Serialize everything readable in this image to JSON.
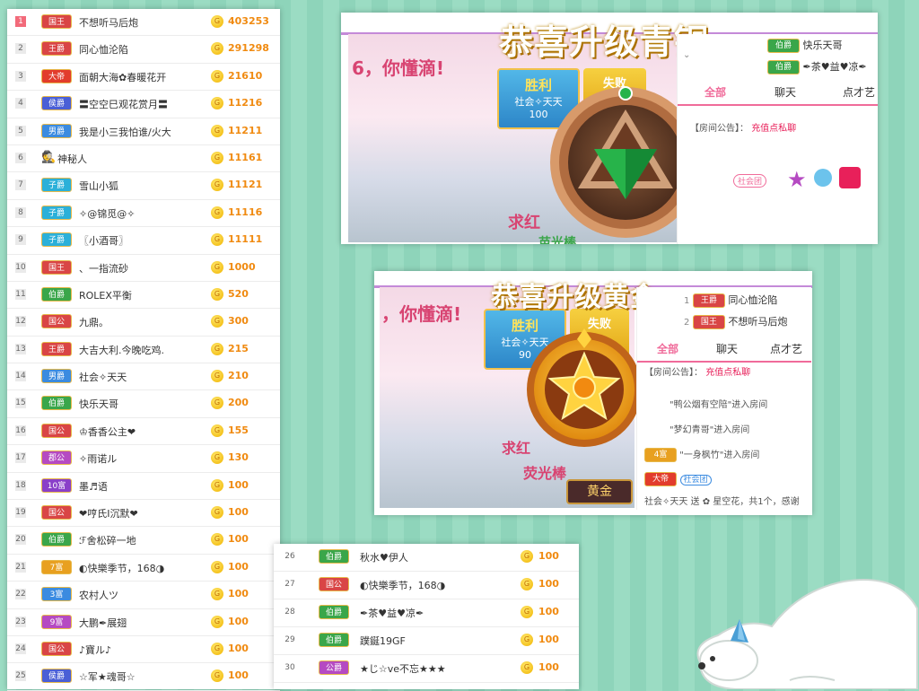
{
  "ranking": [
    {
      "rank": "1",
      "badge": "国王",
      "color": "#d94545",
      "name": "不想听马后炮",
      "score": "403253"
    },
    {
      "rank": "2",
      "badge": "王爵",
      "color": "#d94545",
      "name": "同心恤沦陷",
      "score": "291298"
    },
    {
      "rank": "3",
      "badge": "大帝",
      "color": "#e23c2c",
      "name": "面朝大海✿春暖花开",
      "score": "21610"
    },
    {
      "rank": "4",
      "badge": "侯爵",
      "color": "#4a5fd6",
      "name": "〓空空巳观花赏月〓",
      "score": "11216"
    },
    {
      "rank": "5",
      "badge": "男爵",
      "color": "#3b8be0",
      "name": "我是小三我怕谁/火大",
      "score": "11211"
    },
    {
      "rank": "6",
      "badge": "",
      "color": "",
      "name": "神秘人",
      "score": "11161"
    },
    {
      "rank": "7",
      "badge": "子爵",
      "color": "#2bb0d9",
      "name": "雪山小狐",
      "score": "11121"
    },
    {
      "rank": "8",
      "badge": "子爵",
      "color": "#2bb0d9",
      "name": "✧@锦觅@✧",
      "score": "11116"
    },
    {
      "rank": "9",
      "badge": "子爵",
      "color": "#2bb0d9",
      "name": "〖小酒哥〗",
      "score": "11111"
    },
    {
      "rank": "10",
      "badge": "国王",
      "color": "#d94545",
      "name": "、一指流砂",
      "score": "1000"
    },
    {
      "rank": "11",
      "badge": "伯爵",
      "color": "#3aa64a",
      "name": "ROLEX平衡",
      "score": "520"
    },
    {
      "rank": "12",
      "badge": "国公",
      "color": "#d94545",
      "name": "九鼎。",
      "score": "300"
    },
    {
      "rank": "13",
      "badge": "王爵",
      "color": "#d94545",
      "name": "大吉大利.今晚吃鸡.",
      "score": "215"
    },
    {
      "rank": "14",
      "badge": "男爵",
      "color": "#3b8be0",
      "name": "社会✧天天",
      "score": "210"
    },
    {
      "rank": "15",
      "badge": "伯爵",
      "color": "#3aa64a",
      "name": "快乐天哥",
      "score": "200"
    },
    {
      "rank": "16",
      "badge": "国公",
      "color": "#d94545",
      "name": "♔香香公主❤",
      "score": "155"
    },
    {
      "rank": "17",
      "badge": "郡公",
      "color": "#b54ac2",
      "name": "✧雨诺ル",
      "score": "130"
    },
    {
      "rank": "18",
      "badge": "10富",
      "color": "#8a3fc9",
      "name": "墨♬语",
      "score": "100"
    },
    {
      "rank": "19",
      "badge": "国公",
      "color": "#d94545",
      "name": "❤哼氏I沉默❤",
      "score": "100"
    },
    {
      "rank": "20",
      "badge": "伯爵",
      "color": "#3aa64a",
      "name": "ℱ舍松碎一地",
      "score": "100"
    },
    {
      "rank": "21",
      "badge": "7富",
      "color": "#e8a020",
      "name": "◐快樂季节，168◑",
      "score": "100"
    },
    {
      "rank": "22",
      "badge": "3富",
      "color": "#3b8be0",
      "name": "农村人ツ",
      "score": "100"
    },
    {
      "rank": "23",
      "badge": "9富",
      "color": "#b54ac2",
      "name": "大鹏✒展翅",
      "score": "100"
    },
    {
      "rank": "24",
      "badge": "国公",
      "color": "#d94545",
      "name": "♪寶ル♪",
      "score": "100"
    },
    {
      "rank": "25",
      "badge": "侯爵",
      "color": "#4a5fd6",
      "name": "☆军★魂哥☆",
      "score": "100"
    }
  ],
  "ranking_more": [
    {
      "rank": "26",
      "badge": "伯爵",
      "color": "#3aa64a",
      "name": "秋水♥伊人",
      "score": "100"
    },
    {
      "rank": "27",
      "badge": "国公",
      "color": "#d94545",
      "name": "◐快樂季节，168◑",
      "score": "100"
    },
    {
      "rank": "28",
      "badge": "伯爵",
      "color": "#3aa64a",
      "name": "✒茶♥益♥凉✒",
      "score": "100"
    },
    {
      "rank": "29",
      "badge": "伯爵",
      "color": "#3aa64a",
      "name": "蹼鋋19GF",
      "score": "100"
    },
    {
      "rank": "30",
      "badge": "公爵",
      "color": "#b54ac2",
      "name": "★じ☆ve不忘★★★",
      "score": "100"
    }
  ],
  "bronze": {
    "banner": "恭喜升级青铜",
    "slogan": "6，你懂滴!",
    "win": "胜利",
    "lose": "失败",
    "team": "社会✧天天",
    "count": "100",
    "text_red": "求红",
    "text_green": "苗光棒",
    "tabs": [
      "全部",
      "聊天",
      "点才艺"
    ],
    "notice_label": "【房间公告】：",
    "notice_value": "充值点私聊",
    "top_users": [
      {
        "badge": "伯爵",
        "color": "#3aa64a",
        "name": "快乐天哥"
      },
      {
        "badge": "伯爵",
        "color": "#3aa64a",
        "name": "✒茶♥益♥凉✒"
      }
    ],
    "club": "社会团",
    "level_color": "#1aa84a"
  },
  "gold": {
    "banner": "恭喜升级黄金",
    "slogan": "，你懂滴!",
    "win": "胜利",
    "lose": "失败",
    "team": "社会✧天天",
    "count": "90",
    "text_red": "求红",
    "text_green": "荧光棒",
    "tabs": [
      "全部",
      "聊天",
      "点才艺"
    ],
    "notice_label": "【房间公告】：",
    "notice_value": "充值点私聊",
    "top_users": [
      {
        "rank": "1",
        "badge": "王爵",
        "color": "#d94545",
        "name": "同心恤沦陷"
      },
      {
        "rank": "2",
        "badge": "国王",
        "color": "#d94545",
        "name": "不想听马后炮"
      }
    ],
    "enter_lines": [
      "\"鸭公烟有空陪\"进入房间",
      "\"梦幻青哥\"进入房间",
      "\"一身枫竹\"进入房间"
    ],
    "enter_badge": "4富",
    "footer_badge": "大帝",
    "club": "社会团",
    "footer_text": "社会✧天天 送 ✿ 星空花，共1个，感谢",
    "label": "黄金"
  }
}
